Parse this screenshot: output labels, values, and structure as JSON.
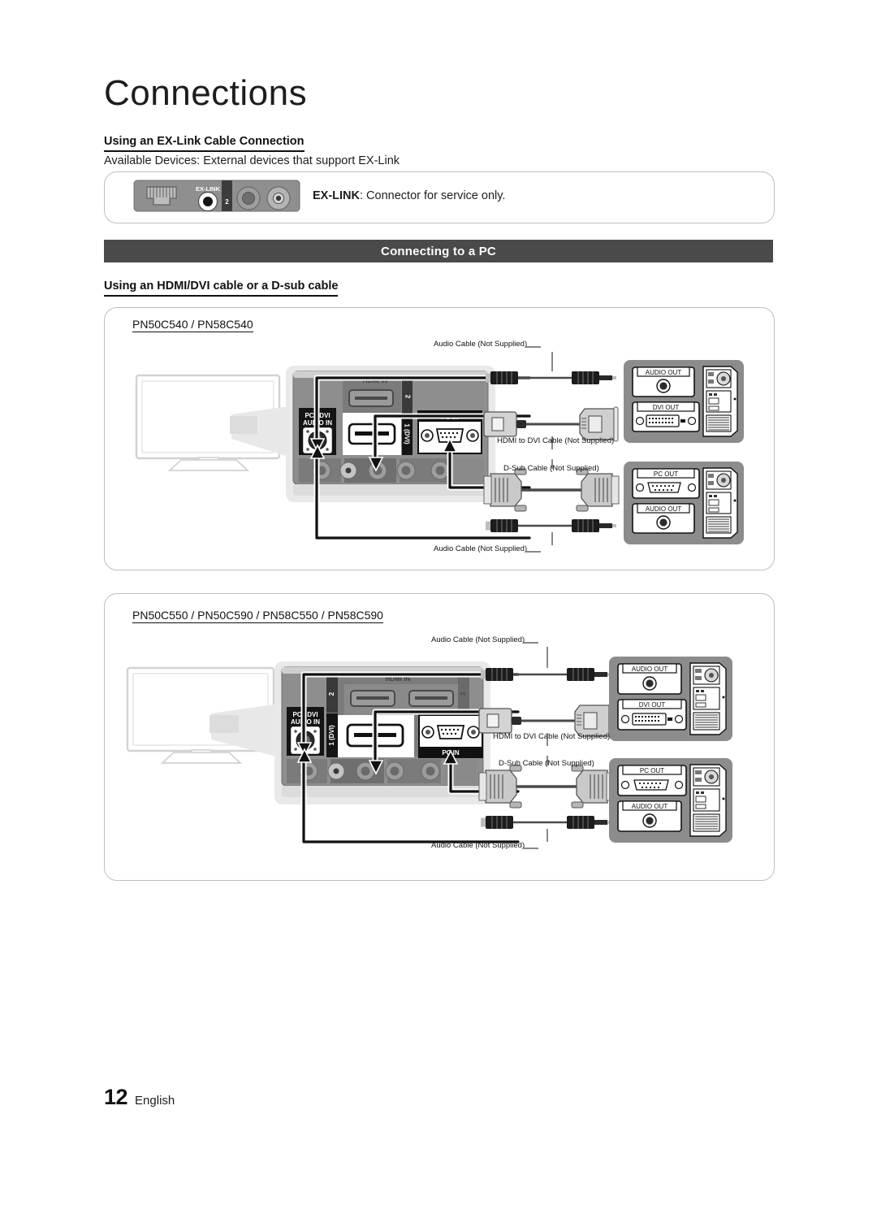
{
  "page": {
    "title": "Connections",
    "footer_number": "12",
    "footer_language": "English"
  },
  "exlink_section": {
    "heading": "Using an EX-Link Cable Connection",
    "available_devices": "Available Devices: External devices that support EX-Link",
    "note_bold": "EX-LINK",
    "note_rest": ": Connector for service only.",
    "panel": {
      "exlink_label": "EX-LINK",
      "port_number": "2"
    }
  },
  "pc_section": {
    "band_title": "Connecting to a PC",
    "heading": "Using an HDMI/DVI cable or a D-sub cable"
  },
  "diagram1": {
    "models": "PN50C540 / PN58C540",
    "tv_panel": {
      "audio_in_label_line1": "PC / DVI",
      "audio_in_label_line2": "AUDIO IN",
      "hdmi_group_label": "HDMI IN",
      "hdmi_port_top": "2",
      "hdmi_port_bottom": "1 (DVI)",
      "pc_in_label": "PC IN"
    },
    "cables": {
      "audio_top": "Audio Cable (Not Supplied)",
      "hdmi_dvi": "HDMI to DVI Cable (Not Supplied)",
      "dsub": "D-Sub Cable (Not Supplied)",
      "audio_bottom": "Audio Cable (Not Supplied)"
    },
    "pc_box_top": {
      "audio_out": "AUDIO OUT",
      "video_out": "DVI OUT"
    },
    "pc_box_bottom": {
      "video_out": "PC OUT",
      "audio_out": "AUDIO OUT"
    }
  },
  "diagram2": {
    "models": "PN50C550 / PN50C590 / PN58C550 / PN58C590",
    "tv_panel": {
      "audio_in_label_line1": "PC / DVI",
      "audio_in_label_line2": "AUDIO IN",
      "hdmi_group_label": "HDMI IN",
      "hdmi_port_left": "2",
      "hdmi_port_right": "3",
      "hdmi_port_bottom": "1 (DVI)",
      "pc_in_label": "PC IN"
    },
    "cables": {
      "audio_top": "Audio Cable (Not Supplied)",
      "hdmi_dvi": "HDMI to DVI Cable (Not Supplied)",
      "dsub": "D-Sub Cable (Not Supplied)",
      "audio_bottom": "Audio Cable (Not Supplied)"
    },
    "pc_box_top": {
      "audio_out": "AUDIO OUT",
      "video_out": "DVI OUT"
    },
    "pc_box_bottom": {
      "video_out": "PC OUT",
      "audio_out": "AUDIO OUT"
    }
  },
  "colors": {
    "band_bg": "#4a4a4a",
    "card_border": "#bfbfbf",
    "panel_dark": "#7d7d7d",
    "panel_mid": "#9a9a9a",
    "panel_light": "#e4e4e4",
    "text": "#1a1a1a"
  }
}
